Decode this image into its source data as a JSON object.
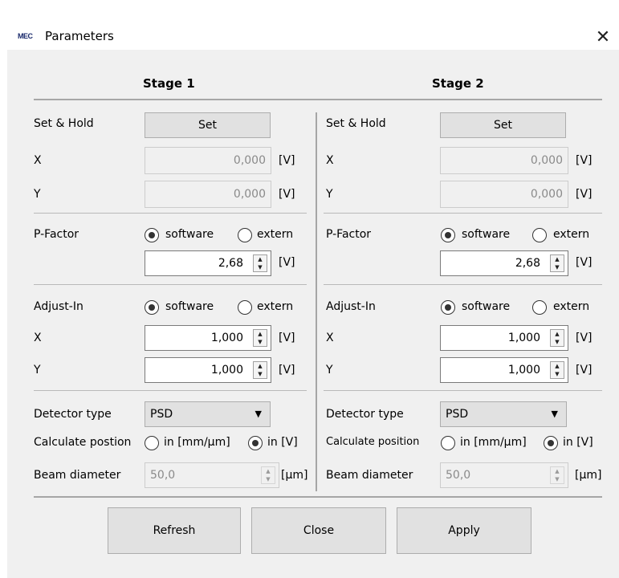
{
  "window": {
    "app_icon_text": "MEC",
    "title": "Parameters",
    "close_symbol": "✕"
  },
  "stage1": {
    "header": "Stage 1",
    "set_hold": {
      "label": "Set & Hold",
      "button": "Set",
      "x_label": "X",
      "x_value": "0,000",
      "x_unit": "[V]",
      "y_label": "Y",
      "y_value": "0,000",
      "y_unit": "[V]"
    },
    "p_factor": {
      "label": "P-Factor",
      "opt_software": "software",
      "opt_extern": "extern",
      "selected": "software",
      "value": "2,68",
      "unit": "[V]"
    },
    "adjust_in": {
      "label": "Adjust-In",
      "opt_software": "software",
      "opt_extern": "extern",
      "selected": "software",
      "x_label": "X",
      "x_value": "1,000",
      "x_unit": "[V]",
      "y_label": "Y",
      "y_value": "1,000",
      "y_unit": "[V]"
    },
    "detector": {
      "label": "Detector type",
      "value": "PSD"
    },
    "calc_position": {
      "label": "Calculate postion",
      "opt_mm": "in [mm/µm]",
      "opt_v": "in [V]",
      "selected": "in [V]"
    },
    "beam": {
      "label": "Beam diameter",
      "value": "50,0",
      "unit": "[µm]"
    }
  },
  "stage2": {
    "header": "Stage 2",
    "set_hold": {
      "label": "Set & Hold",
      "button": "Set",
      "x_label": "X",
      "x_value": "0,000",
      "x_unit": "[V]",
      "y_label": "Y",
      "y_value": "0,000",
      "y_unit": "[V]"
    },
    "p_factor": {
      "label": "P-Factor",
      "opt_software": "software",
      "opt_extern": "extern",
      "selected": "software",
      "value": "2,68",
      "unit": "[V]"
    },
    "adjust_in": {
      "label": "Adjust-In",
      "opt_software": "software",
      "opt_extern": "extern",
      "selected": "software",
      "x_label": "X",
      "x_value": "1,000",
      "x_unit": "[V]",
      "y_label": "Y",
      "y_value": "1,000",
      "y_unit": "[V]"
    },
    "detector": {
      "label": "Detector type",
      "value": "PSD"
    },
    "calc_position": {
      "label": "Calculate position",
      "opt_mm": "in [mm/µm]",
      "opt_v": "in [V]",
      "selected": "in [V]"
    },
    "beam": {
      "label": "Beam diameter",
      "value": "50,0",
      "unit": "[µm]"
    }
  },
  "footer": {
    "refresh": "Refresh",
    "close": "Close",
    "apply": "Apply"
  }
}
